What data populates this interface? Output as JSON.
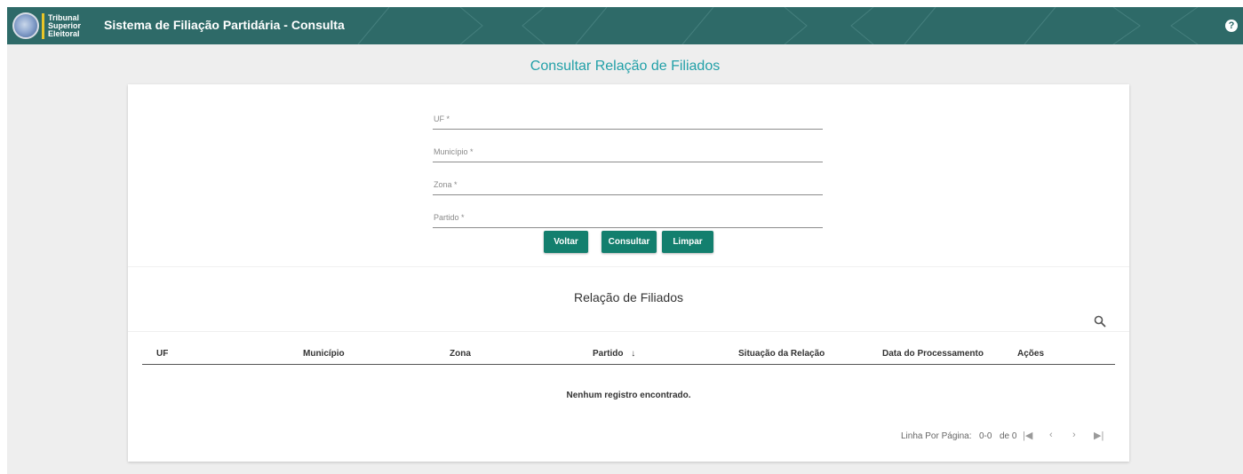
{
  "header": {
    "logo_lines": [
      "Tribunal",
      "Superior",
      "Eleitoral"
    ],
    "app_title": "Sistema de Filiação Partidária - Consulta",
    "help_glyph": "?",
    "colors": {
      "bar": "#2e6a68",
      "logo_accent": "#e8c528"
    }
  },
  "page": {
    "title": "Consultar Relação de Filiados",
    "title_color": "#22a0a8"
  },
  "form": {
    "fields": [
      {
        "label": "UF *"
      },
      {
        "label": "Município *"
      },
      {
        "label": "Zona *"
      },
      {
        "label": "Partido *"
      }
    ],
    "buttons": {
      "back": "Voltar",
      "search": "Consultar",
      "clear": "Limpar"
    },
    "button_color": "#137f6e"
  },
  "results": {
    "title": "Relação de Filiados",
    "search_icon": "search-icon",
    "columns": [
      "UF",
      "Município",
      "Zona",
      "Partido",
      "Situação da Relação",
      "Data do Processamento",
      "Ações"
    ],
    "sort_indicator": "↓",
    "empty_message": "Nenhum registro encontrado.",
    "pagination": {
      "rows_per_page_label": "Linha Por Página:",
      "rows_per_page_value": "0-0",
      "range_of": "de 0",
      "first": "|◀",
      "prev": "‹",
      "next": "›",
      "last": "▶|"
    }
  }
}
